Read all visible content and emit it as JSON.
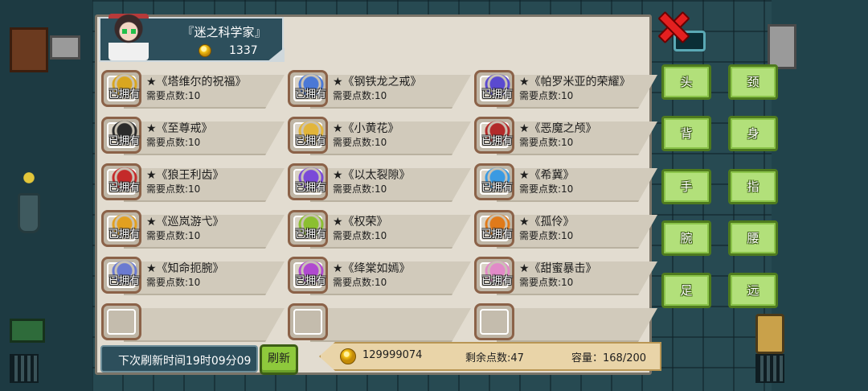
{
  "player": {
    "name": "『迷之科学家』",
    "coins": "1337"
  },
  "owned_label": "已拥有",
  "items": [
    {
      "name": "★《塔维尔的祝福》",
      "cost": "需要点数:10",
      "icon": "ring-gold-gem-icon",
      "color": "#d9a620"
    },
    {
      "name": "★《钢铁龙之戒》",
      "cost": "需要点数:10",
      "icon": "ring-steel-blue-icon",
      "color": "#4a78d6"
    },
    {
      "name": "★《帕罗米亚的荣耀》",
      "cost": "需要点数:10",
      "icon": "ring-crystal-icon",
      "color": "#5a4ad0"
    },
    {
      "name": "★《至尊戒》",
      "cost": "需要点数:10",
      "icon": "ring-green-gem-icon",
      "color": "#2b2b2b"
    },
    {
      "name": "★《小黄花》",
      "cost": "需要点数:10",
      "icon": "ring-yellow-flower-icon",
      "color": "#e2b53a"
    },
    {
      "name": "★《恶魔之颅》",
      "cost": "需要点数:10",
      "icon": "ring-demon-skull-icon",
      "color": "#b22a2a"
    },
    {
      "name": "★《狼王利齿》",
      "cost": "需要点数:10",
      "icon": "ring-wolf-fang-icon",
      "color": "#c42a2a"
    },
    {
      "name": "★《以太裂隙》",
      "cost": "需要点数:10",
      "icon": "ring-ether-rift-icon",
      "color": "#7a4ad8"
    },
    {
      "name": "★《希冀》",
      "cost": "需要点数:10",
      "icon": "ring-hope-icon",
      "color": "#3a9ae2"
    },
    {
      "name": "★《巡岚游弋》",
      "cost": "需要点数:10",
      "icon": "ring-wing-icon",
      "color": "#e2a020"
    },
    {
      "name": "★《权荣》",
      "cost": "需要点数:10",
      "icon": "ring-leaf-icon",
      "color": "#8bbf30"
    },
    {
      "name": "★《孤伶》",
      "cost": "需要点数:10",
      "icon": "ring-orange-gem-icon",
      "color": "#e07a1a"
    },
    {
      "name": "★《知命扼腕》",
      "cost": "需要点数:10",
      "icon": "ring-fish-icon",
      "color": "#6a7ad0"
    },
    {
      "name": "★《绛棠如嫣》",
      "cost": "需要点数:10",
      "icon": "ring-purple-gem-icon",
      "color": "#b04ad0"
    },
    {
      "name": "★《甜蜜暴击》",
      "cost": "需要点数:10",
      "icon": "ring-bunny-icon",
      "color": "#e28ac8"
    }
  ],
  "empty_slot_count": 3,
  "footer": {
    "refresh_time": "下次刷新时间19时09分09",
    "refresh_button": "刷新",
    "gold": "129999074",
    "points_remaining": "剩余点数:47",
    "capacity": "容量：168/200"
  },
  "categories": [
    "头",
    "颈",
    "背",
    "身",
    "手",
    "指",
    "腕",
    "腰",
    "足",
    "远"
  ],
  "colors": {
    "panel_bg": "#e2dcd0",
    "header_bg": "#2d4f5c",
    "category_button": "#b2e07a",
    "close_red": "#e32020"
  }
}
